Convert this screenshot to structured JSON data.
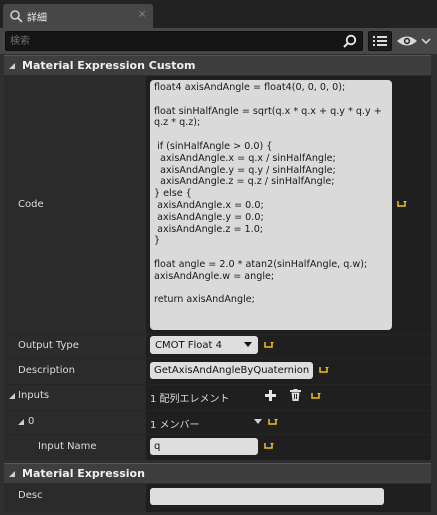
{
  "tab": {
    "title": "詳細",
    "close_glyph": "×"
  },
  "search": {
    "placeholder": "検索"
  },
  "categories": {
    "custom": "Material Expression Custom",
    "expression": "Material Expression"
  },
  "properties": {
    "code": {
      "label": "Code",
      "value": "float4 axisAndAngle = float4(0, 0, 0, 0);\n\nfloat sinHalfAngle = sqrt(q.x * q.x + q.y * q.y + q.z * q.z);\n\n if (sinHalfAngle > 0.0) {\n  axisAndAngle.x = q.x / sinHalfAngle;\n  axisAndAngle.y = q.y / sinHalfAngle;\n  axisAndAngle.z = q.z / sinHalfAngle;\n} else {\n axisAndAngle.x = 0.0;\n axisAndAngle.y = 0.0;\n axisAndAngle.z = 1.0;\n}\n\nfloat angle = 2.0 * atan2(sinHalfAngle, q.w);\naxisAndAngle.w = angle;\n\nreturn axisAndAngle;"
    },
    "output_type": {
      "label": "Output Type",
      "value": "CMOT Float 4"
    },
    "description": {
      "label": "Description",
      "value": "GetAxisAndAngleByQuaternion"
    },
    "inputs": {
      "label": "Inputs",
      "summary": "1 配列エレメント"
    },
    "input_0": {
      "label": "0",
      "summary": "1 メンバー"
    },
    "input_name": {
      "label": "Input Name",
      "value": "q"
    },
    "desc": {
      "label": "Desc",
      "value": ""
    }
  },
  "colors": {
    "reset_arrow": "#f0c020",
    "panel_bg": "#2f2f2f",
    "field_bg": "#dedede"
  }
}
